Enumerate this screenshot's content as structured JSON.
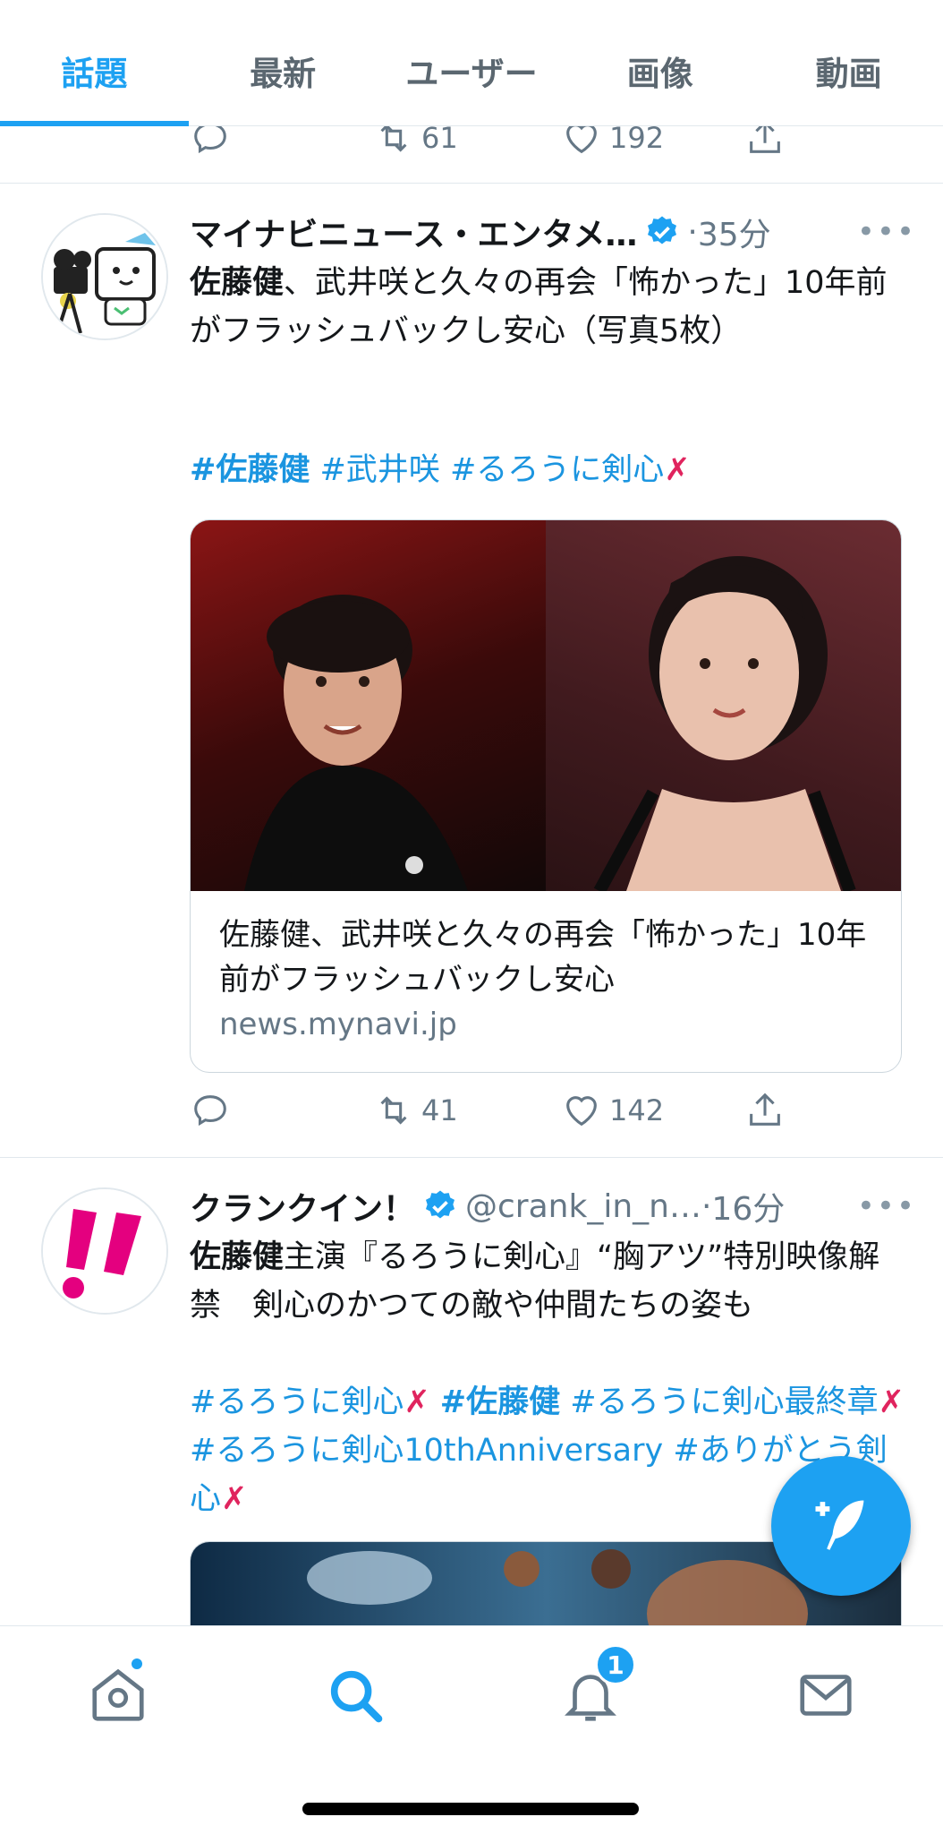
{
  "tabs": [
    {
      "label": "話題",
      "active": true
    },
    {
      "label": "最新",
      "active": false
    },
    {
      "label": "ユーザー",
      "active": false
    },
    {
      "label": "画像",
      "active": false
    },
    {
      "label": "動画",
      "active": false
    }
  ],
  "partial_tweet": {
    "retweets": "61",
    "likes": "192"
  },
  "tweet1": {
    "name": "マイナビニュース・エンタメ…",
    "dot": "·",
    "time": "35分",
    "more": "•••",
    "text_bold": "佐藤健",
    "text_rest": "、武井咲と久々の再会「怖かった」10年前がフラッシュバックし安心（写真5枚）",
    "hashtag_1": "#佐藤健",
    "hashtag_2": "#武井咲",
    "hashtag_3": "#るろうに剣心",
    "emoji": "✗",
    "card": {
      "title": "佐藤健、武井咲と久々の再会「怖かった」10年前がフラッシュバックし安心",
      "domain": "news.mynavi.jp"
    },
    "retweets": "41",
    "likes": "142"
  },
  "tweet2": {
    "name": "クランクイン！",
    "handle": "@crank_in_n…",
    "dot": "·",
    "time": "16分",
    "more": "•••",
    "text_bold": "佐藤健",
    "text_rest": "主演『るろうに剣心』“胸アツ”特別映像解禁　剣心のかつての敵や仲間たちの姿も",
    "hashtag_1": "#るろうに剣心",
    "hashtag_2": "#佐藤健",
    "hashtag_3": "#るろうに剣心最終章",
    "hashtag_4": "#るろうに剣心10thAnniversary",
    "hashtag_5": "#ありがとう剣心",
    "emoji": "✗"
  },
  "bottom_nav": {
    "notifications_badge": "1"
  },
  "colors": {
    "accent": "#1da1f2",
    "hashtag": "#1b95e0",
    "muted": "#657786",
    "sword": "#e0245e"
  }
}
